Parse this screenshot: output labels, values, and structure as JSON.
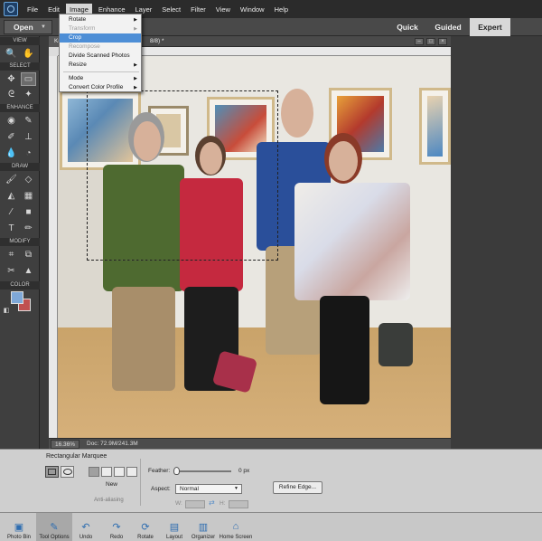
{
  "menubar": {
    "items": [
      "File",
      "Edit",
      "Image",
      "Enhance",
      "Layer",
      "Select",
      "Filter",
      "View",
      "Window",
      "Help"
    ],
    "active": "Image"
  },
  "modebar": {
    "open_label": "Open",
    "modes": [
      "Quick",
      "Guided",
      "Expert"
    ],
    "active_mode": "Expert"
  },
  "toolpanel": {
    "sections": [
      "VIEW",
      "SELECT",
      "ENHANCE",
      "DRAW",
      "MODIFY",
      "COLOR"
    ]
  },
  "document": {
    "tab_label": "Kr",
    "title_rest": "8/8) *",
    "zoom": "16.36%",
    "doc_info": "Doc: 72.9M/241.3M"
  },
  "image_menu": {
    "items": [
      {
        "label": "Rotate",
        "submenu": true,
        "state": "normal"
      },
      {
        "label": "Transform",
        "submenu": true,
        "state": "disabled"
      },
      {
        "label": "Crop",
        "submenu": false,
        "state": "highlight"
      },
      {
        "label": "Recompose",
        "submenu": false,
        "state": "disabled"
      },
      {
        "label": "Divide Scanned Photos",
        "submenu": false,
        "state": "normal"
      },
      {
        "label": "Resize",
        "submenu": true,
        "state": "normal"
      },
      {
        "label": "Mode",
        "submenu": true,
        "state": "normal"
      },
      {
        "label": "Convert Color Profile",
        "submenu": true,
        "state": "normal"
      }
    ]
  },
  "tool_options": {
    "tool_name": "Rectangular Marquee",
    "new_label": "New",
    "antialias_label": "Anti-aliasing",
    "feather_label": "Feather:",
    "feather_value": "0 px",
    "aspect_label": "Aspect:",
    "aspect_value": "Normal",
    "w_label": "W:",
    "h_label": "H:",
    "refine_label": "Refine Edge..."
  },
  "taskbar": {
    "items": [
      "Photo Bin",
      "Tool Options",
      "Undo",
      "Redo",
      "Rotate",
      "Layout",
      "Organizer",
      "Home Screen"
    ],
    "active": "Tool Options"
  }
}
